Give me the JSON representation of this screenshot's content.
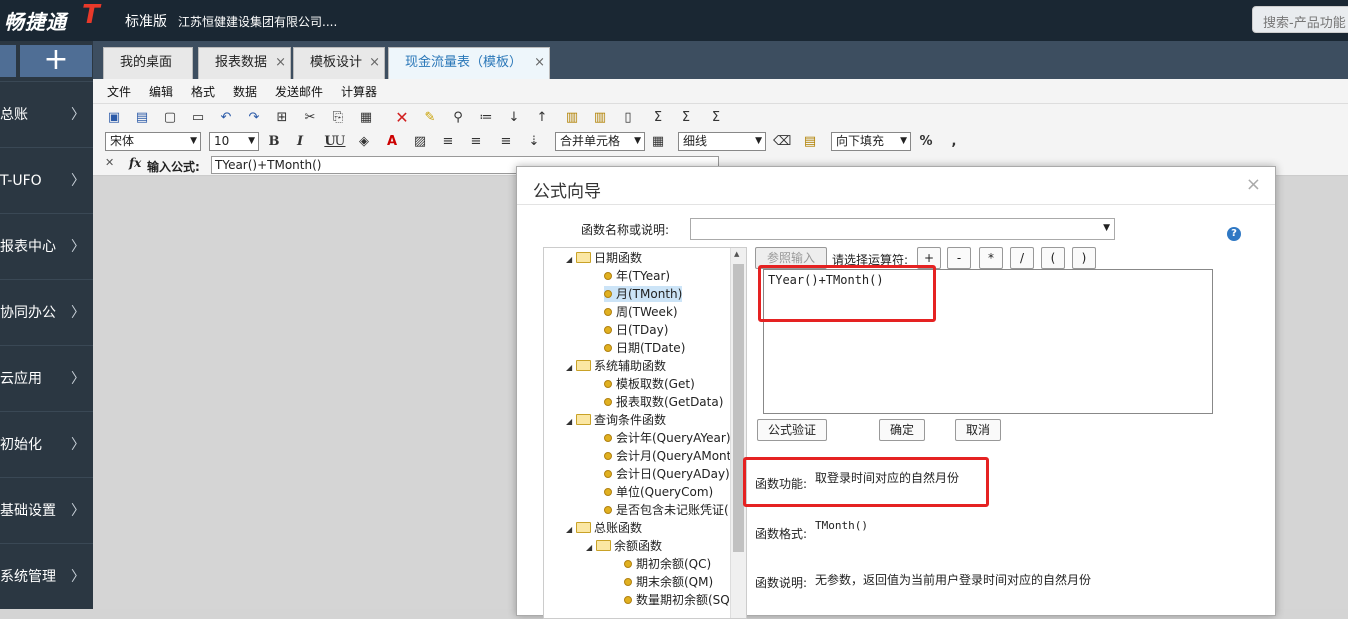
{
  "app": {
    "logo_text": "畅捷通",
    "logo_t": "T",
    "edition": "标准版",
    "company": "江苏恒健建设集团有限公司....",
    "search_placeholder": "搜索-产品功能"
  },
  "sidebar": {
    "add_label": "+",
    "items": [
      {
        "label": "总账"
      },
      {
        "label": "T-UFO"
      },
      {
        "label": "报表中心"
      },
      {
        "label": "协同办公"
      },
      {
        "label": "云应用"
      },
      {
        "label": "初始化"
      },
      {
        "label": "基础设置"
      },
      {
        "label": "系统管理"
      }
    ]
  },
  "tabs": [
    {
      "label": "我的桌面",
      "closable": false
    },
    {
      "label": "报表数据",
      "closable": true
    },
    {
      "label": "模板设计",
      "closable": true
    },
    {
      "label": "现金流量表（模板）",
      "closable": true,
      "active": true
    }
  ],
  "menu": [
    "文件",
    "编辑",
    "格式",
    "数据",
    "发送邮件",
    "计算器"
  ],
  "toolbar": {
    "font": "宋体",
    "font_size": "10",
    "bold": "B",
    "italic": "I",
    "underline": "U",
    "underline2": "U",
    "merge": "合并单元格",
    "border": "细线",
    "fill": "向下填充",
    "percent": "%",
    "comma": ","
  },
  "formula_bar": {
    "fx": "fx",
    "label": "输入公式:",
    "value": "TYear()+TMonth()"
  },
  "dialog": {
    "title": "公式向导",
    "close": "×",
    "fn_label": "函数名称或说明:",
    "help": "?",
    "ref_button": "参照输入",
    "op_label": "请选择运算符:",
    "operators": [
      "+",
      "-",
      "*",
      "/",
      "(",
      ")"
    ],
    "expression": "TYear()+TMonth()",
    "verify_button": "公式验证",
    "ok_button": "确定",
    "cancel_button": "取消",
    "function_desc_label": "函数功能:",
    "function_desc": "取登录时间对应的自然月份",
    "function_format_label": "函数格式:",
    "function_format": "TMonth()",
    "function_note_label": "函数说明:",
    "function_note": "无参数，返回值为当前用户登录时间对应的自然月份"
  },
  "tree": [
    {
      "label": "日期函数",
      "type": "folder",
      "level": 0
    },
    {
      "label": "年(TYear)",
      "type": "leaf",
      "level": 1
    },
    {
      "label": "月(TMonth)",
      "type": "leaf",
      "level": 1,
      "selected": true
    },
    {
      "label": "周(TWeek)",
      "type": "leaf",
      "level": 1
    },
    {
      "label": "日(TDay)",
      "type": "leaf",
      "level": 1
    },
    {
      "label": "日期(TDate)",
      "type": "leaf",
      "level": 1
    },
    {
      "label": "系统辅助函数",
      "type": "folder",
      "level": 0
    },
    {
      "label": "模板取数(Get)",
      "type": "leaf",
      "level": 1
    },
    {
      "label": "报表取数(GetData)",
      "type": "leaf",
      "level": 1
    },
    {
      "label": "查询条件函数",
      "type": "folder",
      "level": 0
    },
    {
      "label": "会计年(QueryAYear)",
      "type": "leaf",
      "level": 1
    },
    {
      "label": "会计月(QueryAMonth",
      "type": "leaf",
      "level": 1
    },
    {
      "label": "会计日(QueryADay)",
      "type": "leaf",
      "level": 1
    },
    {
      "label": "单位(QueryCom)",
      "type": "leaf",
      "level": 1
    },
    {
      "label": "是否包含未记账凭证(",
      "type": "leaf",
      "level": 1
    },
    {
      "label": "总账函数",
      "type": "folder",
      "level": 0
    },
    {
      "label": "余额函数",
      "type": "folder",
      "level": 1
    },
    {
      "label": "期初余额(QC)",
      "type": "leaf",
      "level": 2
    },
    {
      "label": "期末余额(QM)",
      "type": "leaf",
      "level": 2
    },
    {
      "label": "数量期初余额(SQ",
      "type": "leaf",
      "level": 2
    }
  ]
}
